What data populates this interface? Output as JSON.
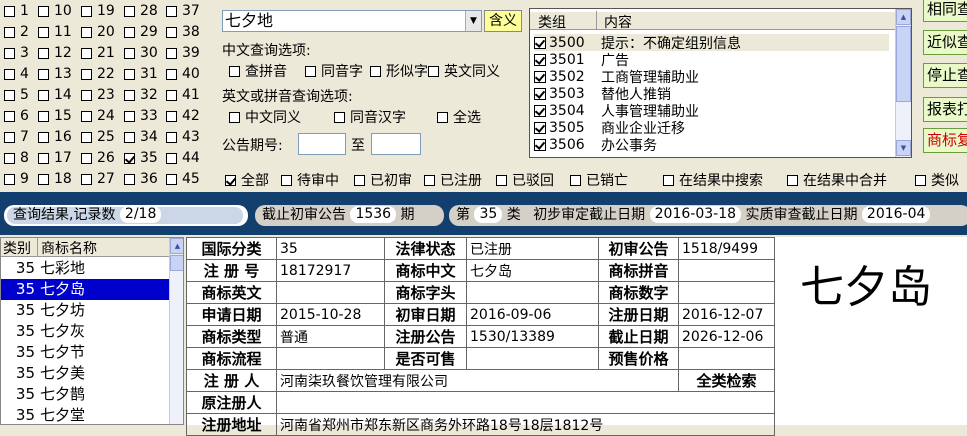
{
  "class_checkboxes": [
    [
      {
        "n": "1",
        "c": false
      },
      {
        "n": "10",
        "c": false
      },
      {
        "n": "19",
        "c": false
      },
      {
        "n": "28",
        "c": false
      },
      {
        "n": "37",
        "c": false
      }
    ],
    [
      {
        "n": "2",
        "c": false
      },
      {
        "n": "11",
        "c": false
      },
      {
        "n": "20",
        "c": false
      },
      {
        "n": "29",
        "c": false
      },
      {
        "n": "38",
        "c": false
      }
    ],
    [
      {
        "n": "3",
        "c": false
      },
      {
        "n": "12",
        "c": false
      },
      {
        "n": "21",
        "c": false
      },
      {
        "n": "30",
        "c": false
      },
      {
        "n": "39",
        "c": false
      }
    ],
    [
      {
        "n": "4",
        "c": false
      },
      {
        "n": "13",
        "c": false
      },
      {
        "n": "22",
        "c": false
      },
      {
        "n": "31",
        "c": false
      },
      {
        "n": "40",
        "c": false
      }
    ],
    [
      {
        "n": "5",
        "c": false
      },
      {
        "n": "14",
        "c": false
      },
      {
        "n": "23",
        "c": false
      },
      {
        "n": "32",
        "c": false
      },
      {
        "n": "41",
        "c": false
      }
    ],
    [
      {
        "n": "6",
        "c": false
      },
      {
        "n": "15",
        "c": false
      },
      {
        "n": "24",
        "c": false
      },
      {
        "n": "33",
        "c": false
      },
      {
        "n": "42",
        "c": false
      }
    ],
    [
      {
        "n": "7",
        "c": false
      },
      {
        "n": "16",
        "c": false
      },
      {
        "n": "25",
        "c": false
      },
      {
        "n": "34",
        "c": false
      },
      {
        "n": "43",
        "c": false
      }
    ],
    [
      {
        "n": "8",
        "c": false
      },
      {
        "n": "17",
        "c": false
      },
      {
        "n": "26",
        "c": false
      },
      {
        "n": "35",
        "c": true
      },
      {
        "n": "44",
        "c": false
      }
    ],
    [
      {
        "n": "9",
        "c": false
      },
      {
        "n": "18",
        "c": false
      },
      {
        "n": "27",
        "c": false
      },
      {
        "n": "36",
        "c": false
      },
      {
        "n": "45",
        "c": false
      }
    ]
  ],
  "search": {
    "value": "七夕地",
    "meaning_button": "含义",
    "cn_options_label": "中文查询选项:",
    "cn_options": [
      "查拼音",
      "同音字",
      "形似字",
      "英文同义"
    ],
    "en_options_label": "英文或拼音查询选项:",
    "en_options": [
      "中文同义",
      "同音汉字",
      "全选"
    ],
    "gazette_label": "公告期号:",
    "gazette_to": "至"
  },
  "categories": {
    "col_group": "类组",
    "col_content": "内容",
    "rows": [
      {
        "code": "3500",
        "text": "提示：不确定组别信息"
      },
      {
        "code": "3501",
        "text": "广告"
      },
      {
        "code": "3502",
        "text": "工商管理辅助业"
      },
      {
        "code": "3503",
        "text": "替他人推销"
      },
      {
        "code": "3504",
        "text": "人事管理辅助业"
      },
      {
        "code": "3505",
        "text": "商业企业迁移"
      },
      {
        "code": "3506",
        "text": "办公事务"
      }
    ]
  },
  "side_buttons": [
    "相同查",
    "近似查",
    "停止查",
    "报表打",
    "商标复"
  ],
  "status_filters": [
    {
      "label": "全部",
      "checked": true
    },
    {
      "label": "待审中",
      "checked": false
    },
    {
      "label": "已初审",
      "checked": false
    },
    {
      "label": "已注册",
      "checked": false
    },
    {
      "label": "已驳回",
      "checked": false
    },
    {
      "label": "已销亡",
      "checked": false
    }
  ],
  "result_options": [
    "在结果中搜索",
    "在结果中合并",
    "类似"
  ],
  "info_bar": {
    "results_label": "查询结果,记录数",
    "results_value": "2/18",
    "deadline_label": "截止初审公告",
    "deadline_value": "1536",
    "deadline_unit": "期",
    "class_prefix": "第",
    "class_value": "35",
    "class_suffix": "类",
    "prelim_label": "初步审定截止日期",
    "prelim_value": "2016-03-18",
    "substantive_label": "实质审查截止日期",
    "substantive_value": "2016-04"
  },
  "list": {
    "col_class": "类别",
    "col_name": "商标名称",
    "rows": [
      {
        "c": "35",
        "name": "七彩地"
      },
      {
        "c": "35",
        "name": "七夕岛"
      },
      {
        "c": "35",
        "name": "七夕坊"
      },
      {
        "c": "35",
        "name": "七夕灰"
      },
      {
        "c": "35",
        "name": "七夕节"
      },
      {
        "c": "35",
        "name": "七夕美"
      },
      {
        "c": "35",
        "name": "七夕鹊"
      },
      {
        "c": "35",
        "name": "七夕堂"
      }
    ]
  },
  "detail": {
    "intl_class_label": "国际分类",
    "intl_class": "35",
    "legal_status_label": "法律状态",
    "legal_status": "已注册",
    "prelim_gazette_label": "初审公告",
    "prelim_gazette": "1518/9499",
    "reg_no_label": "注 册 号",
    "reg_no": "18172917",
    "name_cn_label": "商标中文",
    "name_cn": "七夕岛",
    "pinyin_label": "商标拼音",
    "pinyin": "",
    "name_en_label": "商标英文",
    "name_en": "",
    "letters_label": "商标字头",
    "letters": "",
    "digits_label": "商标数字",
    "digits": "",
    "apply_date_label": "申请日期",
    "apply_date": "2015-10-28",
    "prelim_date_label": "初审日期",
    "prelim_date": "2016-09-06",
    "reg_date_label": "注册日期",
    "reg_date": "2016-12-07",
    "type_label": "商标类型",
    "type": "普通",
    "reg_gazette_label": "注册公告",
    "reg_gazette": "1530/13389",
    "expiry_label": "截止日期",
    "expiry": "2026-12-06",
    "flow_label": "商标流程",
    "flow": "",
    "sellable_label": "是否可售",
    "sellable": "",
    "presale_label": "预售价格",
    "presale": "",
    "registrant_label": "注 册 人",
    "registrant": "河南柒玖餐饮管理有限公司",
    "all_class_search": "全类检索",
    "orig_registrant_label": "原注册人",
    "orig_registrant": "",
    "address_label": "注册地址",
    "address": "河南省郑州市郑东新区商务外环路18号18层1812号"
  },
  "preview": {
    "text": "七夕岛"
  }
}
